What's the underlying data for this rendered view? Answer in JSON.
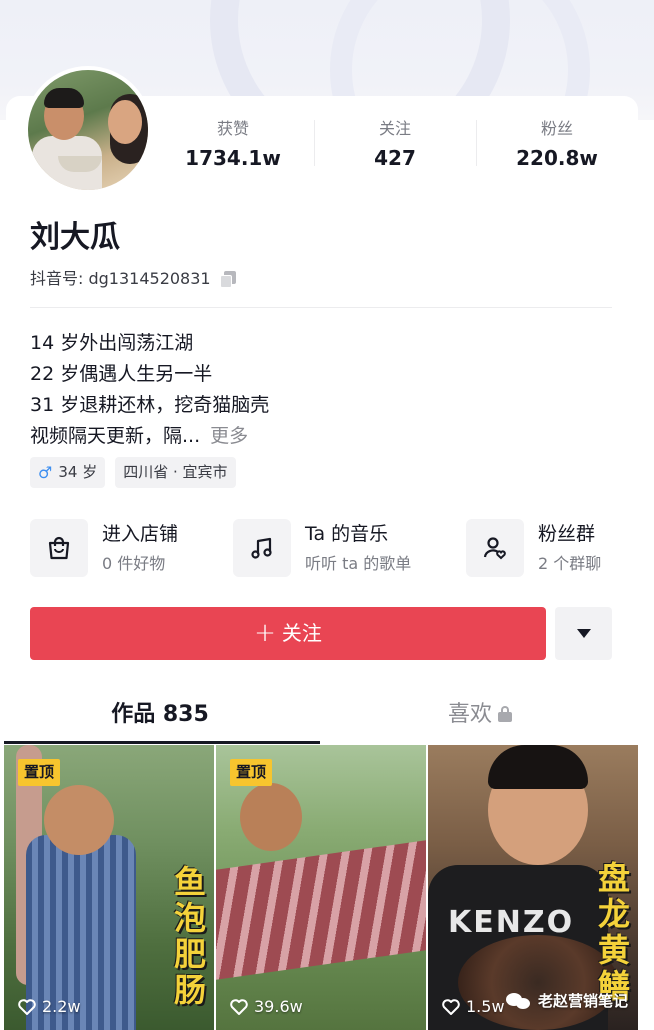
{
  "profile": {
    "name": "刘大瓜",
    "douyin_id": "抖音号: dg1314520831",
    "stats": [
      {
        "label": "获赞",
        "value": "1734.1w"
      },
      {
        "label": "关注",
        "value": "427"
      },
      {
        "label": "粉丝",
        "value": "220.8w"
      }
    ],
    "bio": [
      "14 岁外出闯荡江湖",
      "22 岁偶遇人生另一半",
      "31 岁退耕还林，挖奇猫脑壳",
      "视频隔天更新，隔..."
    ],
    "bio_more": "更多",
    "tags": {
      "gender_symbol": "♂",
      "age": "34 岁",
      "location": "四川省 · 宜宾市"
    }
  },
  "services": [
    {
      "title": "进入店铺",
      "subtitle": "0 件好物",
      "icon": "shopping-bag-icon"
    },
    {
      "title": "Ta 的音乐",
      "subtitle": "听听 ta 的歌单",
      "icon": "music-note-icon"
    },
    {
      "title": "粉丝群",
      "subtitle": "2 个群聊",
      "icon": "fan-group-icon"
    }
  ],
  "actions": {
    "follow_plus": "+",
    "follow_label": "关注",
    "more_icon": "dropdown-triangle-icon"
  },
  "tabs": [
    {
      "label": "作品 835",
      "active": true
    },
    {
      "label": "喜欢",
      "active": false,
      "locked": true
    }
  ],
  "videos": [
    {
      "pinned_label": "置顶",
      "likes": "2.2w",
      "title": "鱼泡肥肠"
    },
    {
      "pinned_label": "置顶",
      "likes": "39.6w",
      "title": ""
    },
    {
      "pinned_label": "",
      "likes": "1.5w",
      "title": "盘龙黄鳝",
      "brand": "KENZO"
    }
  ],
  "watermark": "老赵营销笔记",
  "colors": {
    "follow_red": "#e94553",
    "pin_yellow": "#f7c52e",
    "gender_blue": "#3d8ef0"
  }
}
